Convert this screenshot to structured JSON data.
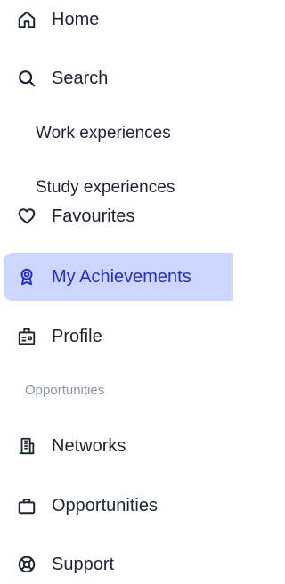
{
  "nav": {
    "home": "Home",
    "search": "Search",
    "search_sub": [
      "Work experiences",
      "Study experiences"
    ],
    "favourites": "Favourites",
    "my_achievements": "My Achievements",
    "profile": "Profile",
    "section_label": "Opportunities",
    "networks": "Networks",
    "opportunities": "Opportunities",
    "support": "Support"
  },
  "icons": {
    "home": "home-icon",
    "search": "search-icon",
    "favourites": "heart-icon",
    "my_achievements": "award-icon",
    "profile": "id-card-icon",
    "networks": "building-icon",
    "opportunities": "briefcase-icon",
    "support": "lifebuoy-icon"
  },
  "colors": {
    "active_bg": "#ccd6ff",
    "active_text": "#2330c8",
    "text": "#1f2433",
    "muted": "#8d93a5"
  }
}
